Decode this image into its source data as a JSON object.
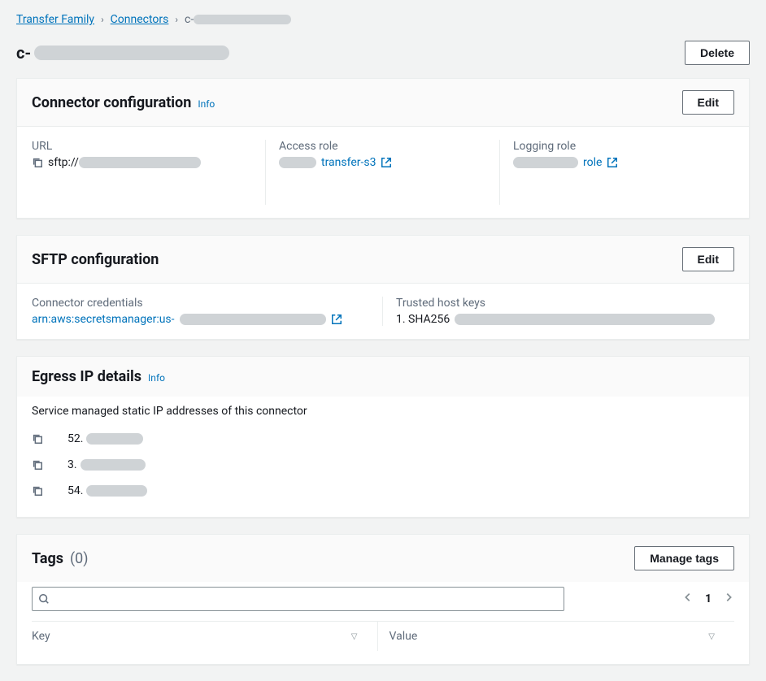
{
  "breadcrumb": {
    "root": "Transfer Family",
    "section": "Connectors",
    "current_prefix": "c-"
  },
  "page": {
    "title_prefix": "c-",
    "delete_label": "Delete"
  },
  "connector_config": {
    "title": "Connector configuration",
    "info_label": "Info",
    "edit_label": "Edit",
    "url_label": "URL",
    "url_value_prefix": "sftp://",
    "access_role_label": "Access role",
    "access_role_value_suffix": "transfer-s3",
    "logging_role_label": "Logging role",
    "logging_role_value_suffix": "role"
  },
  "sftp_config": {
    "title": "SFTP configuration",
    "edit_label": "Edit",
    "creds_label": "Connector credentials",
    "creds_value_prefix": "arn:aws:secretsmanager:us-",
    "hostkeys_label": "Trusted host keys",
    "hostkey_prefix": "1. SHA256"
  },
  "egress": {
    "title": "Egress IP details",
    "info_label": "Info",
    "description": "Service managed static IP addresses of this connector",
    "ips": [
      "52.",
      "3.",
      "54."
    ]
  },
  "tags": {
    "title": "Tags",
    "count_text": "(0)",
    "manage_label": "Manage tags",
    "search_placeholder": "",
    "page_number": "1",
    "key_header": "Key",
    "value_header": "Value"
  }
}
